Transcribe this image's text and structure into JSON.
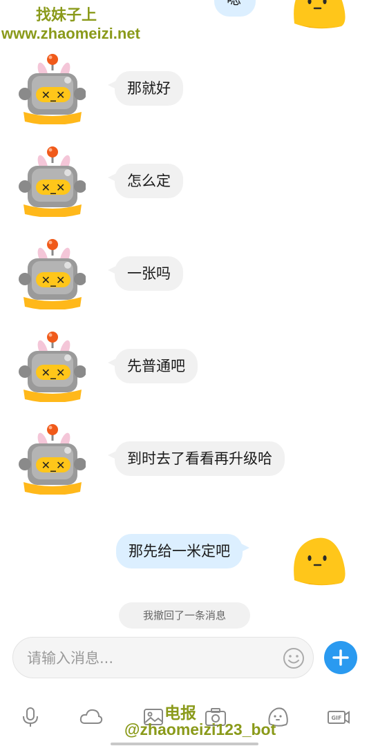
{
  "watermark": {
    "top_title": "找妹子上",
    "top_url": "www.zhaomeizi.net",
    "bottom_title": "电报",
    "bottom_handle": "@zhaomeizi123_bot"
  },
  "messages": [
    {
      "side": "right",
      "text": "嗯"
    },
    {
      "side": "left",
      "text": "那就好"
    },
    {
      "side": "left",
      "text": "怎么定"
    },
    {
      "side": "left",
      "text": "一张吗"
    },
    {
      "side": "left",
      "text": "先普通吧"
    },
    {
      "side": "left",
      "text": "到时去了看看再升级哈"
    },
    {
      "side": "right",
      "text": "那先给一米定吧"
    }
  ],
  "system_notice": "我撤回了一条消息",
  "composer": {
    "placeholder": "请输入消息..."
  },
  "toolbar": {
    "items": [
      "mic-icon",
      "cloud-icon",
      "image-icon",
      "camera-icon",
      "sticker-icon",
      "gif-icon"
    ]
  },
  "colors": {
    "accent": "#2a9af0",
    "bubble_left": "#f1f1f1",
    "bubble_right": "#dcefff",
    "watermark": "#8a9a1a",
    "avatar_yellow": "#ffc61a"
  }
}
